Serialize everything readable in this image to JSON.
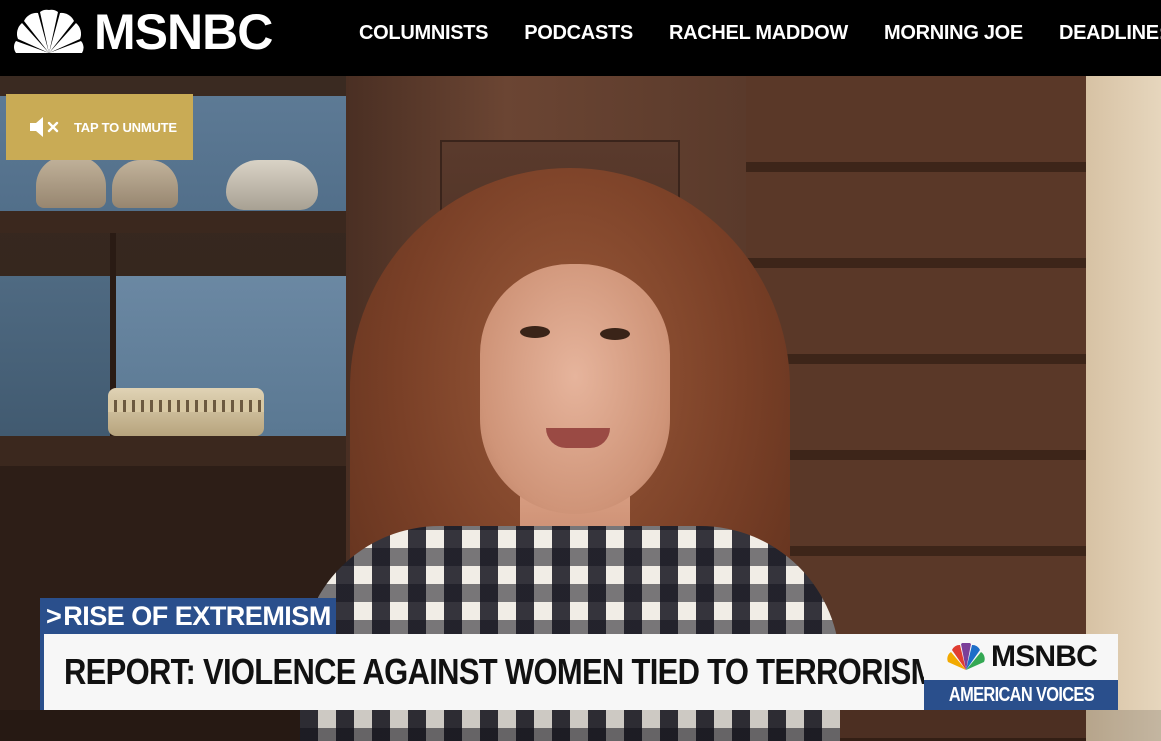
{
  "header": {
    "logo_text": "MSNBC",
    "nav": [
      {
        "label": "COLUMNISTS"
      },
      {
        "label": "PODCASTS"
      },
      {
        "label": "RACHEL MADDOW"
      },
      {
        "label": "MORNING JOE"
      },
      {
        "label": "DEADLINE:"
      }
    ]
  },
  "player": {
    "unmute_label": "TAP TO UNMUTE",
    "lower_third": {
      "tag": "RISE OF EXTREMISM",
      "headline": "REPORT: VIOLENCE AGAINST WOMEN TIED TO TERRORISM",
      "network_bug": "MSNBC",
      "show_name": "AMERICAN VOICES"
    }
  },
  "colors": {
    "nav_background": "#000000",
    "unmute_button": "#c9ab55",
    "lower_third_blue": "#2a4f8c",
    "headline_bar": "#f7f7f7"
  }
}
